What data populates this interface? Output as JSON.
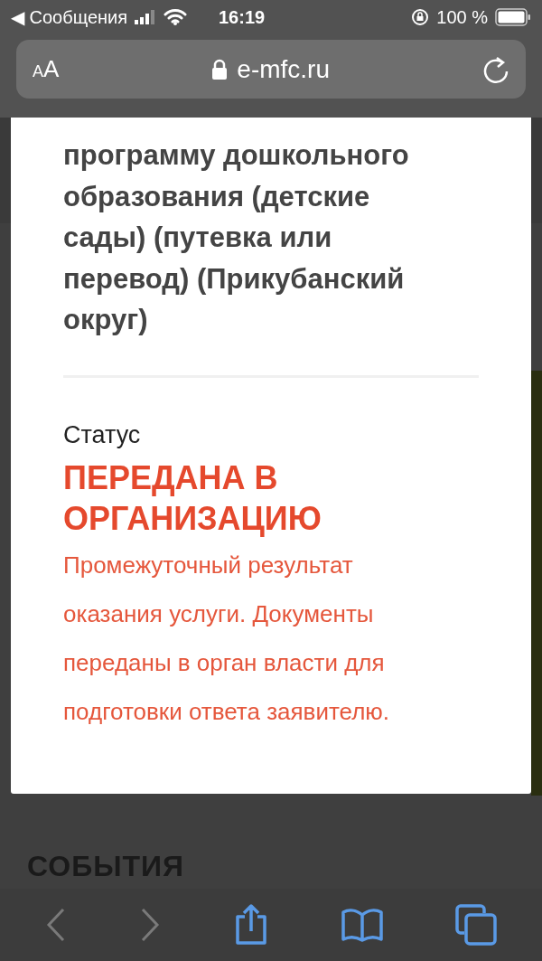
{
  "status_bar": {
    "back_label": "◀ Сообщения",
    "time": "16:19",
    "battery": "100 %"
  },
  "address_bar": {
    "text_size_button": "AA",
    "url": "e-mfc.ru"
  },
  "card": {
    "title_lines": [
      "программу дошкольного",
      "образования (детские",
      "сады) (путевка или",
      "перевод) (Прикубанский",
      "округ)"
    ],
    "status_label": "Статус",
    "status_value": "ПЕРЕДАНА В ОРГАНИЗАЦИЮ",
    "description_lines": [
      "Промежуточный результат",
      "оказания услуги. Документы",
      "переданы в орган власти для",
      "подготовки ответа заявителю."
    ]
  },
  "section_heading": "СОБЫТИЯ",
  "toolbar": [
    {
      "kind": "back",
      "disabled": true
    },
    {
      "kind": "forward",
      "disabled": true
    },
    {
      "kind": "share",
      "disabled": false
    },
    {
      "kind": "bookmarks",
      "disabled": false
    },
    {
      "kind": "tabs",
      "disabled": false
    }
  ]
}
